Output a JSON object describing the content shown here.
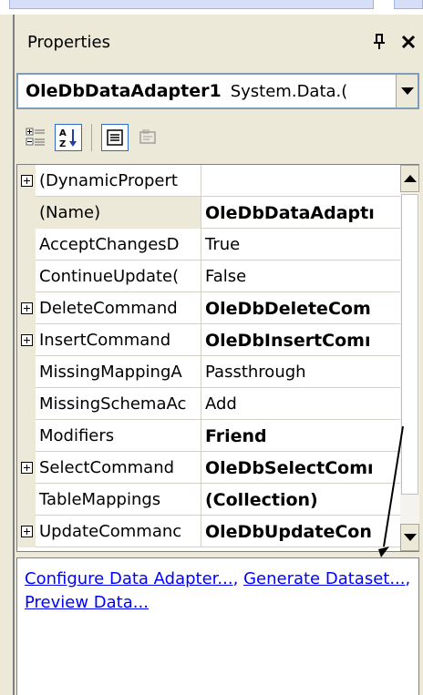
{
  "panel": {
    "title": "Properties",
    "pin_glyph": "չ",
    "close_glyph": "✕"
  },
  "object_selector": {
    "name": "OleDbDataAdapter1",
    "type": "System.Data.("
  },
  "properties": [
    {
      "name": "(DynamicPropert",
      "value": "",
      "expandable": true,
      "bold": false,
      "shaded": false
    },
    {
      "name": "(Name)",
      "value": "OleDbDataAdaptı",
      "expandable": false,
      "bold": true,
      "shaded": true
    },
    {
      "name": "AcceptChangesD",
      "value": "True",
      "expandable": false,
      "bold": false,
      "shaded": false
    },
    {
      "name": "ContinueUpdate(",
      "value": "False",
      "expandable": false,
      "bold": false,
      "shaded": false
    },
    {
      "name": "DeleteCommand",
      "value": "OleDbDeleteCom",
      "expandable": true,
      "bold": true,
      "shaded": false
    },
    {
      "name": "InsertCommand",
      "value": "OleDbInsertComı",
      "expandable": true,
      "bold": true,
      "shaded": false
    },
    {
      "name": "MissingMappingA",
      "value": "Passthrough",
      "expandable": false,
      "bold": false,
      "shaded": false
    },
    {
      "name": "MissingSchemaAc",
      "value": "Add",
      "expandable": false,
      "bold": false,
      "shaded": false
    },
    {
      "name": "Modifiers",
      "value": "Friend",
      "expandable": false,
      "bold": true,
      "shaded": false
    },
    {
      "name": "SelectCommand",
      "value": "OleDbSelectComı",
      "expandable": true,
      "bold": true,
      "shaded": false
    },
    {
      "name": "TableMappings",
      "value": "(Collection)",
      "expandable": false,
      "bold": true,
      "shaded": false
    },
    {
      "name": "UpdateCommanc",
      "value": "OleDbUpdateCon",
      "expandable": true,
      "bold": true,
      "shaded": false
    }
  ],
  "commands": {
    "configure": "Configure Data Adapter...",
    "generate": "Generate Dataset...",
    "preview": "Preview Data...",
    "separator": ","
  },
  "colors": {
    "link": "#0000ff",
    "panel_bg": "#ece9d8",
    "selector_border": "#7f9db9"
  }
}
